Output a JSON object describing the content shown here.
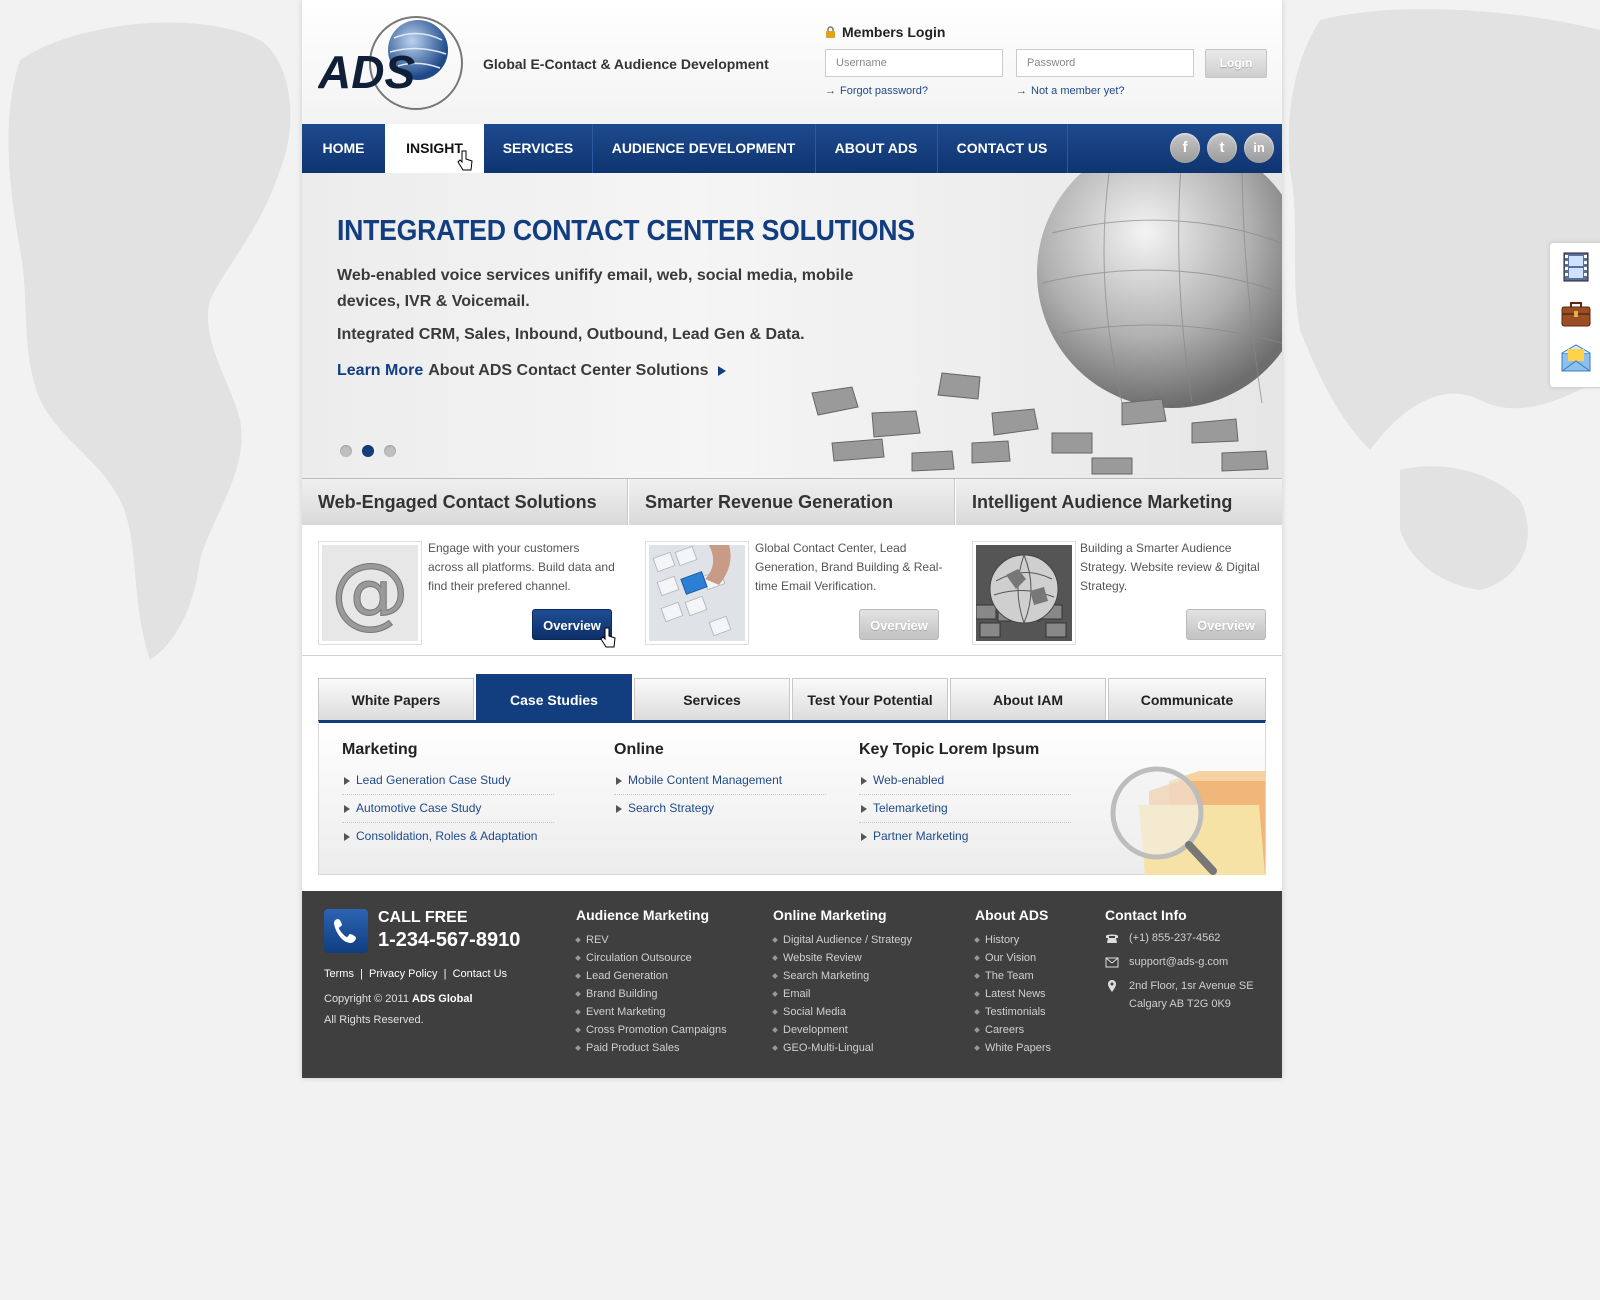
{
  "header": {
    "tagline": "Global E-Contact & Audience Development",
    "login_title": "Members Login",
    "username_placeholder": "Username",
    "password_placeholder": "Password",
    "login_button": "Login",
    "forgot_link": "Forgot password?",
    "member_link": "Not a member yet?"
  },
  "logo": {
    "text": "ADS"
  },
  "nav": {
    "items": [
      "HOME",
      "INSIGHT",
      "SERVICES",
      "AUDIENCE DEVELOPMENT",
      "ABOUT ADS",
      "CONTACT US"
    ],
    "active": "INSIGHT",
    "social": [
      "f",
      "t",
      "in"
    ]
  },
  "hero": {
    "title": "INTEGRATED CONTACT CENTER SOLUTIONS",
    "line1": "Web-enabled voice services unifify email, web, social media, mobile devices, IVR & Voicemail.",
    "line2": "Integrated CRM, Sales, Inbound, Outbound, Lead Gen & Data.",
    "learn_more": "Learn More",
    "learn_more_rest": "About ADS Contact Center Solutions",
    "active_slide": 2,
    "slide_count": 3
  },
  "features": [
    {
      "title": "Web-Engaged Contact Solutions",
      "text": "Engage with your customers across all platforms. Build data and find their prefered channel.",
      "button": "Overview",
      "button_state": "active"
    },
    {
      "title": "Smarter Revenue Generation",
      "text": "Global Contact Center, Lead Generation, Brand Building & Real-time Email Verification.",
      "button": "Overview",
      "button_state": "default"
    },
    {
      "title": "Intelligent Audience Marketing",
      "text": "Building a Smarter  Audience Strategy. Website review & Digital Strategy.",
      "button": "Overview",
      "button_state": "default"
    }
  ],
  "tabs": {
    "items": [
      "White Papers",
      "Case Studies",
      "Services",
      "Test Your Potential",
      "About IAM",
      "Communicate"
    ],
    "active": "Case Studies",
    "columns": [
      {
        "heading": "Marketing",
        "links": [
          "Lead Generation Case Study",
          "Automotive Case Study",
          "Consolidation, Roles & Adaptation"
        ]
      },
      {
        "heading": "Online",
        "links": [
          "Mobile Content Management",
          "Search Strategy"
        ]
      },
      {
        "heading": "Key Topic Lorem Ipsum",
        "links": [
          "Web-enabled",
          "Telemarketing",
          "Partner Marketing"
        ]
      }
    ]
  },
  "footer": {
    "call_free": "CALL FREE",
    "phone": "1-234-567-8910",
    "links": [
      "Terms",
      "Privacy Policy",
      "Contact Us"
    ],
    "copyright": "Copyright © 2011",
    "company": "ADS Global",
    "rights": "All Rights Reserved.",
    "columns": [
      {
        "heading": "Audience Marketing",
        "items": [
          "REV",
          "Circulation Outsource",
          "Lead Generation",
          "Brand Building",
          "Event Marketing",
          "Cross Promotion Campaigns",
          "Paid Product Sales"
        ]
      },
      {
        "heading": "Online Marketing",
        "items": [
          "Digital Audience / Strategy",
          "Website Review",
          "Search Marketing",
          "Email",
          "Social Media",
          "Development",
          "GEO-Multi-Lingual"
        ]
      },
      {
        "heading": "About ADS",
        "items": [
          "History",
          "Our Vision",
          "The Team",
          "Latest News",
          "Testimonials",
          "Careers",
          "White Papers"
        ]
      }
    ],
    "contact": {
      "heading": "Contact Info",
      "phone": "(+1) 855-237-4562",
      "email": "support@ads-g.com",
      "address_line1": "2nd Floor, 1sr Avenue SE",
      "address_line2": "Calgary AB T2G 0K9"
    }
  },
  "colors": {
    "brand_blue": "#123e80",
    "footer_bg": "#3f3f3f",
    "page_bg": "#f2f2f2"
  },
  "floating_tools": [
    "film-icon",
    "briefcase-icon",
    "mail-icon"
  ]
}
